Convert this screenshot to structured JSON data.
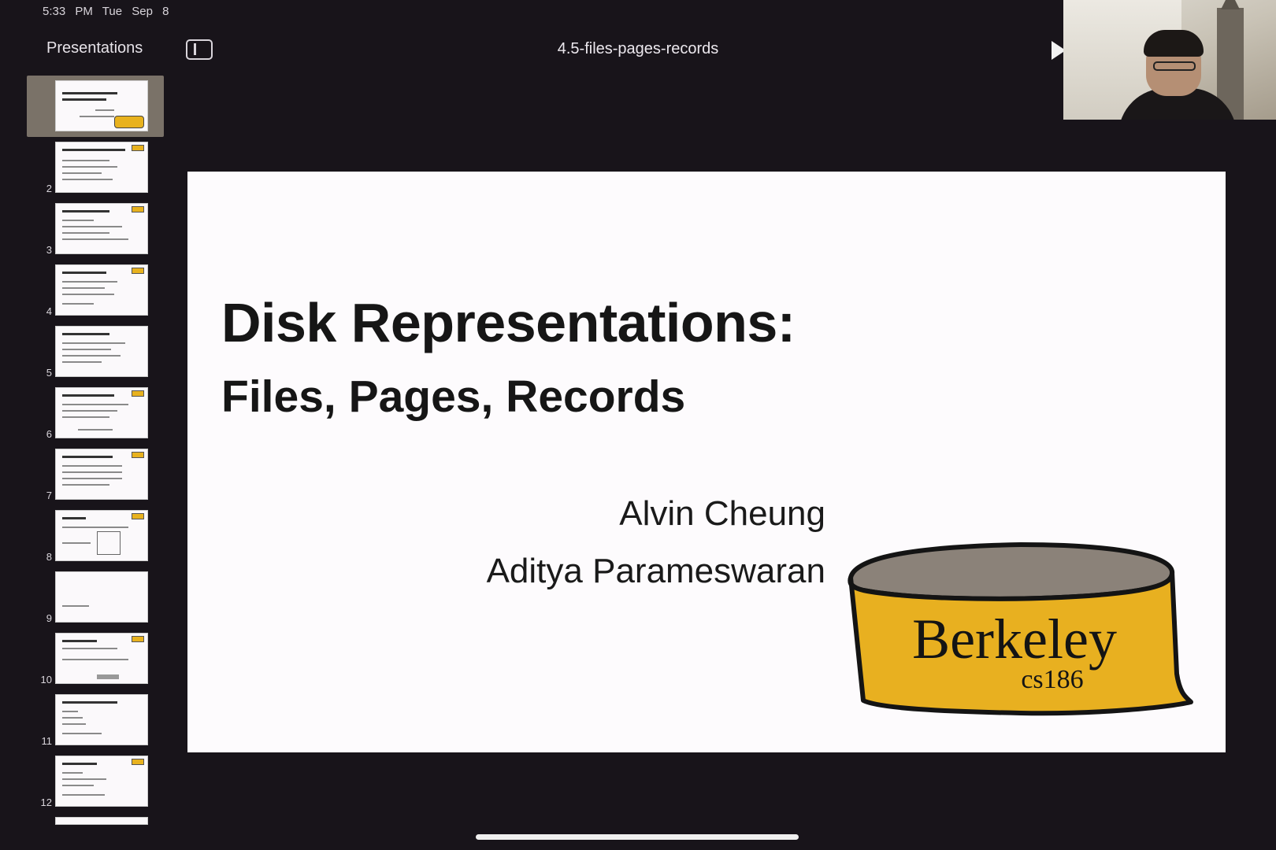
{
  "status_bar": {
    "time": "5:33 PM",
    "date": "Tue Sep 8"
  },
  "toolbar": {
    "back_label": "Presentations",
    "sidebar_icon": "sidebar-icon",
    "document_title": "4.5-files-pages-records",
    "play_icon": "play-icon"
  },
  "navigator": {
    "slides": [
      {
        "number": "",
        "selected": true
      },
      {
        "number": "2"
      },
      {
        "number": "3"
      },
      {
        "number": "4"
      },
      {
        "number": "5"
      },
      {
        "number": "6"
      },
      {
        "number": "7"
      },
      {
        "number": "8"
      },
      {
        "number": "9"
      },
      {
        "number": "10"
      },
      {
        "number": "11"
      },
      {
        "number": "12"
      }
    ]
  },
  "slide": {
    "title": "Disk Representations:",
    "subtitle": "Files, Pages, Records",
    "authors": [
      "Alvin Cheung",
      "Aditya Parameswaran"
    ],
    "logo_text": "Berkeley",
    "logo_subtext": "cs186",
    "logo_color": "#e8b020"
  }
}
